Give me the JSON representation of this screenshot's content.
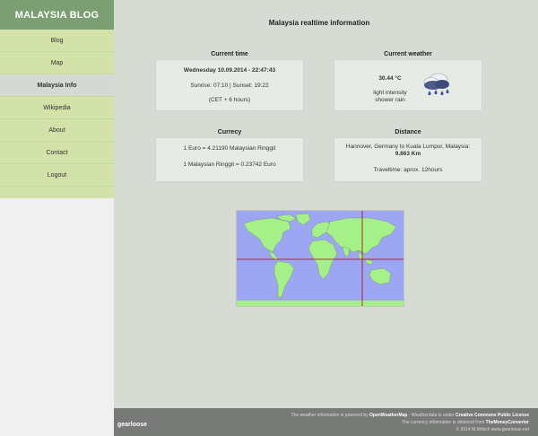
{
  "sidebar": {
    "brand": "MALAYSIA BLOG",
    "items": [
      {
        "label": "Blog"
      },
      {
        "label": "Map"
      },
      {
        "label": "Malaysia Info"
      },
      {
        "label": "Wikipedia"
      },
      {
        "label": "About"
      },
      {
        "label": "Contact"
      },
      {
        "label": "Logout"
      }
    ],
    "active_index": 2
  },
  "main": {
    "title": "Malaysia realtime information",
    "current_time": {
      "title": "Current time",
      "datetime": "Wednesday 10.09.2014 - 22:47:43",
      "sun": "Sunrise: 07:10 | Sunset: 19:22",
      "offset": "(CET + 6 hours)"
    },
    "current_weather": {
      "title": "Current weather",
      "temperature": "30.44 °C",
      "desc_line1": "light intensity",
      "desc_line2": "shower rain",
      "icon": "rain-cloud-icon"
    },
    "currency": {
      "title": "Currecy",
      "line1": "1 Euro = 4.21190 Malaysian Ringgit",
      "line2": "1 Malaysian Ringgit = 0.23742 Euro"
    },
    "distance": {
      "title": "Distance",
      "line1": "Hannover, Germany to Kuala Lumpur, Malaysia:",
      "distance_value": "9.863 Km",
      "traveltime": "Traveltime: aprox. 12hours"
    }
  },
  "footer": {
    "logo": "gearloose",
    "line1_pre": "The weather information is powered by ",
    "line1_link1": "OpenWeatherMap",
    "line1_mid": " - Weatherdata is under ",
    "line1_link2": "Creative Commons Public License",
    "line2_pre": "The currency information is obtained from ",
    "line2_link": "TheMoneyConverter",
    "line3": "© 2014 M.Wilsch www.gearloose.net"
  },
  "colors": {
    "brand_bg": "#7b9e73",
    "nav_bg": "#d2e2a8",
    "main_bg": "#d6dbd3",
    "map_ocean": "#9da6f2",
    "map_land": "#a6f08a",
    "map_marker": "#b00000"
  }
}
